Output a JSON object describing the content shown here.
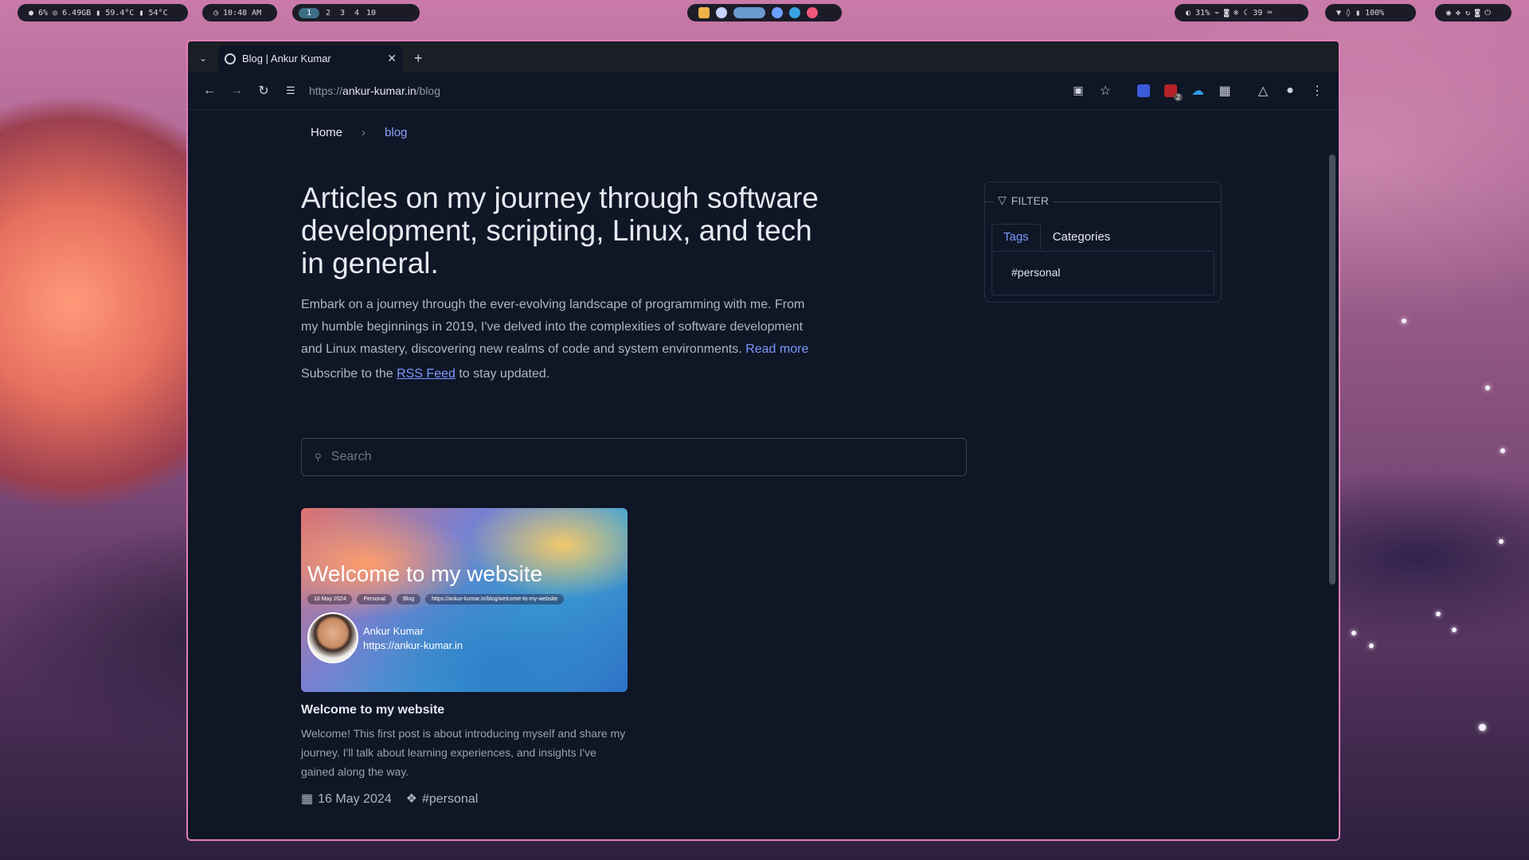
{
  "topbar": {
    "stats": "● 6% ◎ 6.49GB ▮ 59.4°C ▮ 54°C",
    "clock": "◷ 10:48 AM",
    "workspaces": [
      "1",
      "2",
      "3",
      "4",
      "10"
    ],
    "active_workspace": "1",
    "system_tray": "◐ 31% ⌁ ◙ ❄ ☾ 39 ⌨",
    "battery": "▼ ◊ ▮ 100%",
    "power": "◉ ✤ ↻ ◙ ⏻",
    "tray_icon_colors": [
      "#f0b24a",
      "#c8d2ff",
      "#6a9ad0",
      "#6aa0ff",
      "#3aa3e0",
      "#f2557a"
    ]
  },
  "browser": {
    "tab_title": "Blog | Ankur Kumar",
    "url_prefix": "https://",
    "url_host": "ankur-kumar.in",
    "url_path": "/blog",
    "extension_badge": "2"
  },
  "page": {
    "breadcrumb": {
      "home": "Home",
      "current": "blog"
    },
    "heading": "Articles on my journey through software development, scripting, Linux, and tech in general.",
    "intro": "Embark on a journey through the ever-evolving landscape of programming with me. From my humble beginnings in 2019, I've delved into the complexities of software development and Linux mastery, discovering new realms of code and system environments.",
    "read_more": "Read more",
    "subscribe_prefix": "Subscribe to the",
    "rss_link": "RSS Feed",
    "subscribe_suffix": "to stay updated.",
    "search_placeholder": "Search",
    "filter": {
      "legend": "FILTER",
      "tabs": [
        "Tags",
        "Categories"
      ],
      "active_tab": "Tags",
      "tags": [
        "#personal"
      ]
    },
    "posts": [
      {
        "thumb_title": "Welcome to my website",
        "thumb_chips": [
          "16 May 2024",
          "Personal",
          "Blog",
          "https://ankur-kumar.in/blog/welcome-to-my-website"
        ],
        "thumb_author": "Ankur Kumar",
        "thumb_site": "https://ankur-kumar.in",
        "title": "Welcome to my website",
        "excerpt": "Welcome! This first post is about introducing myself and share my journey. I'll talk about learning experiences, and insights I've gained along the way.",
        "date": "16 May 2024",
        "tag": "#personal"
      }
    ]
  }
}
